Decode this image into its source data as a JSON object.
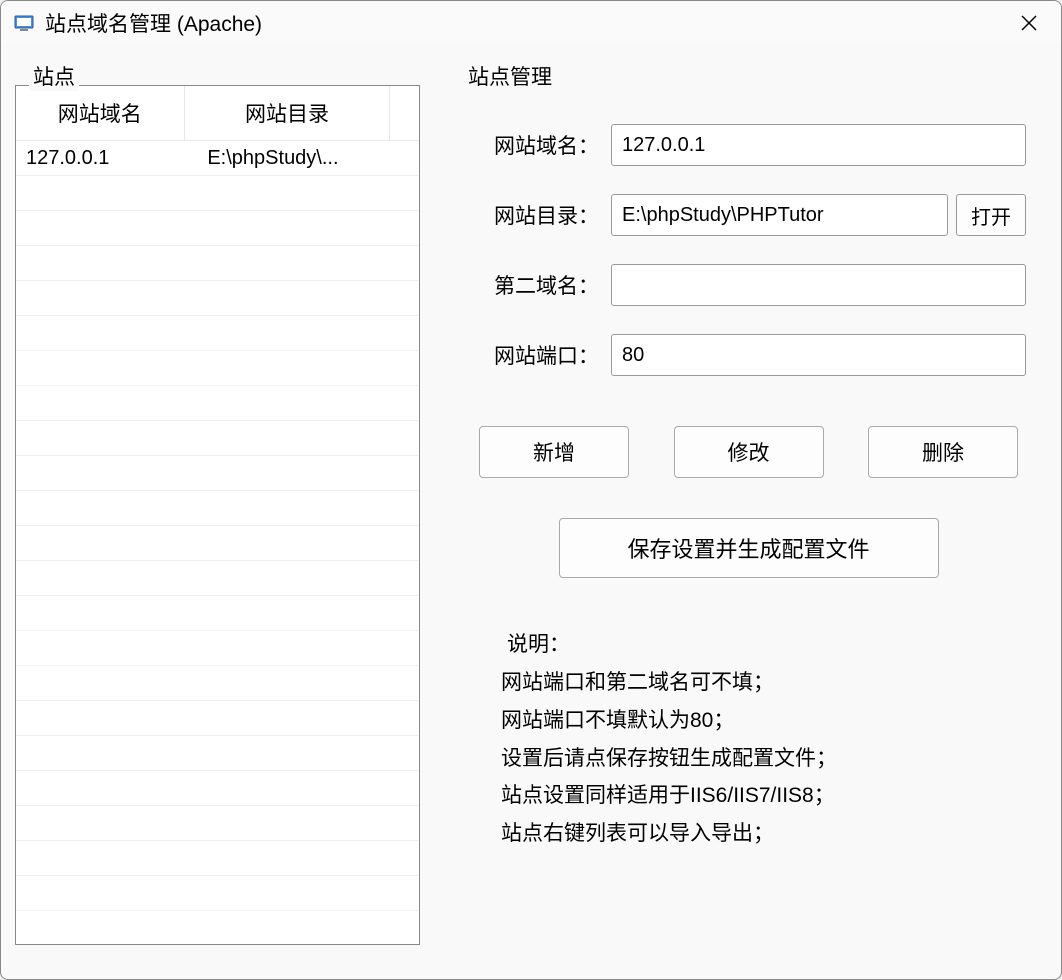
{
  "window": {
    "title": "站点域名管理 (Apache)"
  },
  "sidebar": {
    "legend": "站点",
    "columns": [
      "网站域名",
      "网站目录"
    ],
    "rows": [
      {
        "domain": "127.0.0.1",
        "dir": "E:\\phpStudy\\..."
      }
    ]
  },
  "form": {
    "legend": "站点管理",
    "domain_label": "网站域名：",
    "domain_value": "127.0.0.1",
    "dir_label": "网站目录：",
    "dir_value": "E:\\phpStudy\\PHPTutor",
    "open_label": "打开",
    "second_domain_label": "第二域名：",
    "second_domain_value": "",
    "port_label": "网站端口：",
    "port_value": "80",
    "add_label": "新增",
    "modify_label": "修改",
    "delete_label": "删除",
    "save_label": "保存设置并生成配置文件"
  },
  "help": {
    "title": "说明：",
    "lines": [
      "网站端口和第二域名可不填；",
      "网站端口不填默认为80；",
      "设置后请点保存按钮生成配置文件；",
      "站点设置同样适用于IIS6/IIS7/IIS8；",
      "站点右键列表可以导入导出；"
    ]
  }
}
